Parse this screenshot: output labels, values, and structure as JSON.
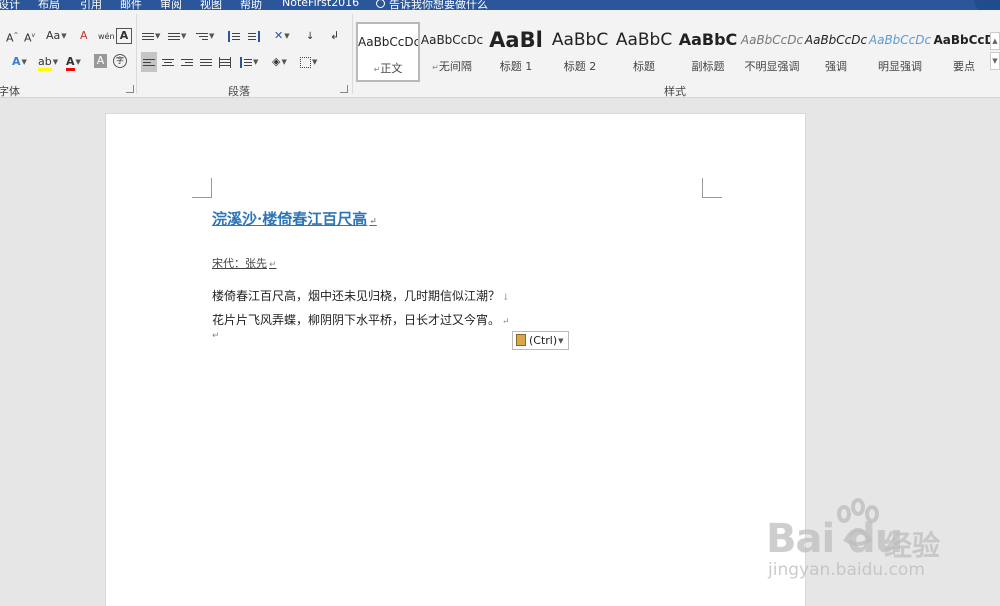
{
  "menubar": {
    "items": [
      "设计",
      "布局",
      "引用",
      "邮件",
      "审阅",
      "视图",
      "帮助",
      "NoteFirst2016"
    ],
    "tell_me": "告诉我你想要做什么"
  },
  "ribbon": {
    "font_group": {
      "label": "字体",
      "buttons": {
        "grow_font": "A",
        "shrink_font": "A",
        "change_case": "Aa",
        "clear_format": "A",
        "phonetic": "wén",
        "char_border": "A",
        "text_effect": "A",
        "highlight": "ab",
        "font_color": "A",
        "char_shading": "A",
        "enclose_char": "字"
      }
    },
    "paragraph_group": {
      "label": "段落"
    },
    "styles_group": {
      "label": "样式",
      "styles": [
        {
          "sample": "AaBbCcDc",
          "name": "正文",
          "mark": "↵"
        },
        {
          "sample": "AaBbCcDc",
          "name": "无间隔",
          "mark": "↵"
        },
        {
          "sample": "AaBl",
          "name": "标题 1"
        },
        {
          "sample": "AaBbC",
          "name": "标题 2"
        },
        {
          "sample": "AaBbC",
          "name": "标题"
        },
        {
          "sample": "AaBbC",
          "name": "副标题"
        },
        {
          "sample": "AaBbCcDc",
          "name": "不明显强调"
        },
        {
          "sample": "AaBbCcDc",
          "name": "强调"
        },
        {
          "sample": "AaBbCcDc",
          "name": "明显强调"
        },
        {
          "sample": "AaBbCcD",
          "name": "要点"
        }
      ]
    }
  },
  "document": {
    "title": "浣溪沙·楼倚春江百尺高",
    "author": "宋代：张先",
    "lines": [
      "楼倚春江百尺高，烟中还未见归桡，几时期信似江潮？",
      "花片片飞风弄蝶，柳阴阴下水平桥，日长才过又今宵。"
    ],
    "paragraph_mark": "↵",
    "line_break_mark": "↓",
    "paste_options": "(Ctrl)"
  },
  "watermark": {
    "logo": "Bai du",
    "cn": "经验",
    "url": "jingyan.baidu.com"
  },
  "colors": {
    "menubar": "#2b579a",
    "ribbon": "#f3f3f3",
    "title": "#2e75b6",
    "font_color_bar": "#ff0000",
    "highlight_bar": "#ffff00"
  }
}
